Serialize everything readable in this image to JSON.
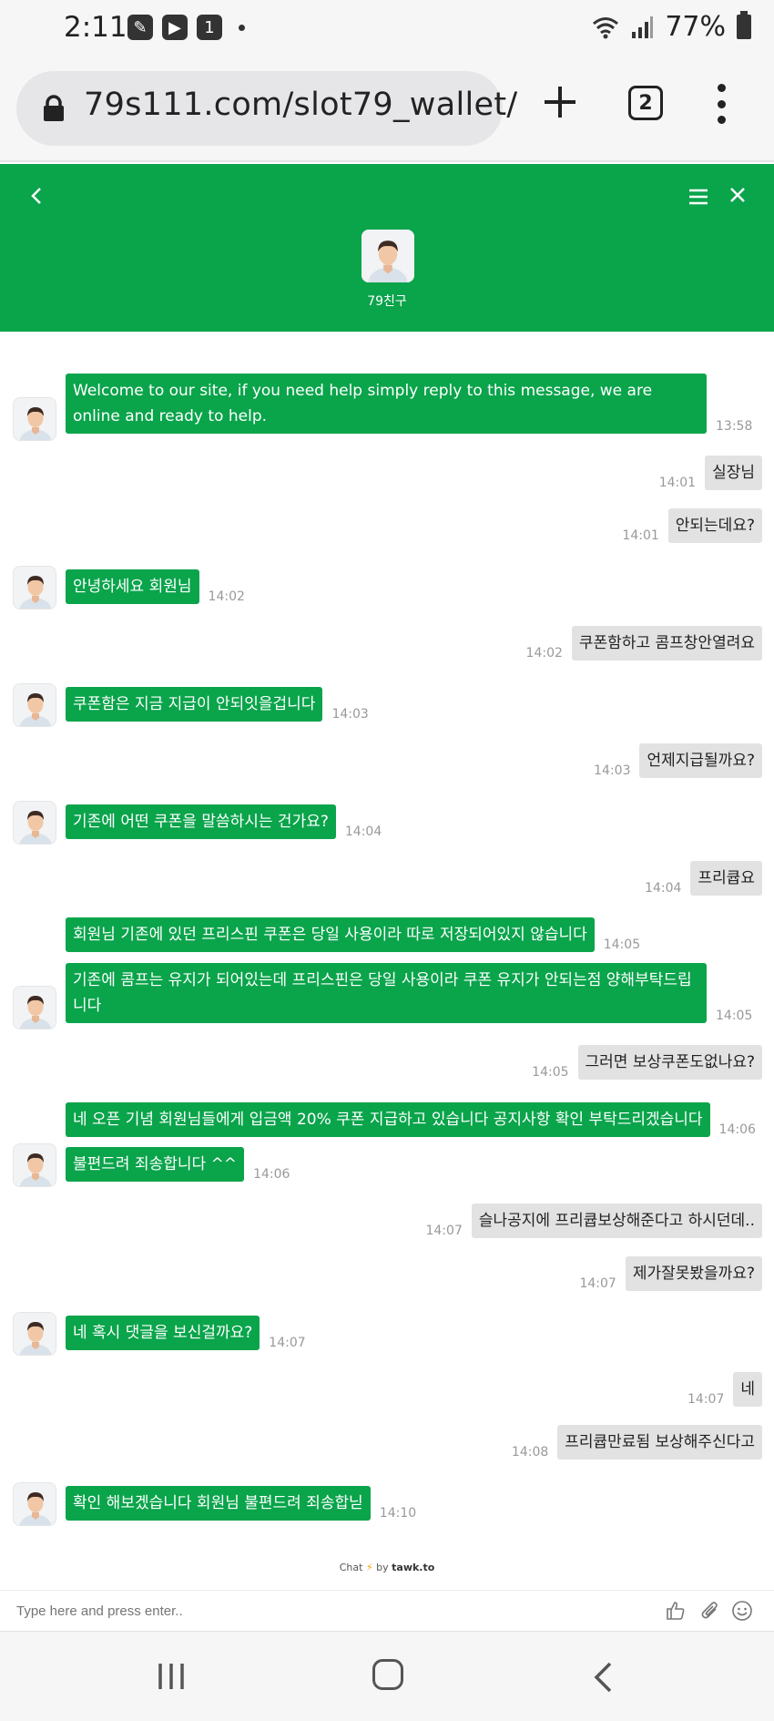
{
  "status_bar": {
    "time": "2:11",
    "notif_count": "1",
    "battery": "77%"
  },
  "browser": {
    "url": "79s111.com/slot79_wallet/",
    "tab_count": "2"
  },
  "chat": {
    "agent_name": "79친구",
    "messages": [
      {
        "from": "agent",
        "text": "Welcome to our site, if you need help simply reply to this message, we are online and ready to help.",
        "time": "13:58"
      },
      {
        "from": "visitor",
        "text": "실장님",
        "time": "14:01"
      },
      {
        "from": "visitor",
        "text": "안되는데요?",
        "time": "14:01"
      },
      {
        "from": "agent",
        "text": "안녕하세요 회원님",
        "time": "14:02"
      },
      {
        "from": "visitor",
        "text": "쿠폰함하고 콤프창안열려요",
        "time": "14:02"
      },
      {
        "from": "agent",
        "text": "쿠폰함은 지금 지급이 안되잇을겁니다",
        "time": "14:03"
      },
      {
        "from": "visitor",
        "text": "언제지급될까요?",
        "time": "14:03"
      },
      {
        "from": "agent",
        "text": "기존에 어떤 쿠폰을 말씀하시는 건가요?",
        "time": "14:04"
      },
      {
        "from": "visitor",
        "text": "프리큡요",
        "time": "14:04"
      },
      {
        "from": "agent",
        "text": "회원님 기존에 있던 프리스핀 쿠폰은 당일 사용이라 따로 저장되어있지 않습니다",
        "time": "14:05"
      },
      {
        "from": "agent",
        "text": "기존에 콤프는 유지가 되어있는데 프리스핀은 당일 사용이라 쿠폰 유지가 안되는점 양해부탁드립니다",
        "time": "14:05"
      },
      {
        "from": "visitor",
        "text": "그러면 보상쿠폰도없나요?",
        "time": "14:05"
      },
      {
        "from": "agent",
        "text": "네 오픈 기념 회원님들에게 입금액 20% 쿠폰 지급하고 있습니다 공지사항 확인 부탁드리겠습니다",
        "time": "14:06"
      },
      {
        "from": "agent",
        "text": "불편드려 죄송합니다 ^^",
        "time": "14:06"
      },
      {
        "from": "visitor",
        "text": "슬나공지에 프리큡보상해준다고 하시던데..",
        "time": "14:07"
      },
      {
        "from": "visitor",
        "text": "제가잘못봤을까요?",
        "time": "14:07"
      },
      {
        "from": "agent",
        "text": "네 혹시 댓글을 보신걸까요?",
        "time": "14:07"
      },
      {
        "from": "visitor",
        "text": "네",
        "time": "14:07"
      },
      {
        "from": "visitor",
        "text": "프리큡만료됨 보상해주신다고",
        "time": "14:08"
      },
      {
        "from": "agent",
        "text": "확인 해보겠습니다 회원님 불편드려 죄송합닏",
        "time": "14:10"
      }
    ],
    "powered_prefix": "Chat",
    "powered_by": "by",
    "powered_brand": "tawk.to",
    "input_placeholder": "Type here and press enter..",
    "colors": {
      "agent_bubble": "#0aa44b",
      "visitor_bubble": "#e2e2e2",
      "header": "#0aa44b"
    }
  }
}
